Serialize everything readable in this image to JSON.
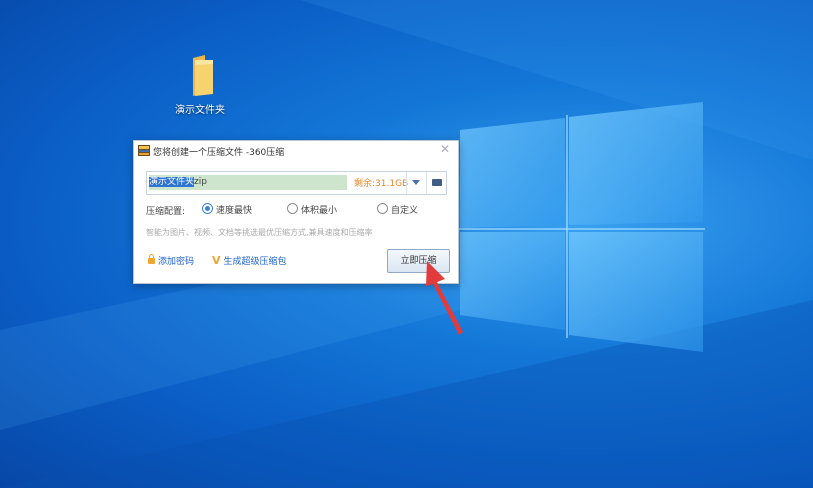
{
  "desktop": {
    "icons": [
      {
        "label": "演示文件夹",
        "icon": "folder-icon"
      }
    ]
  },
  "dialog": {
    "title": "您将创建一个压缩文件 -360压缩",
    "close_icon": "close-icon",
    "path": {
      "selected_text": "演示文件夹",
      "extension_text": "zip",
      "free_space": "剩余:31.1GB"
    },
    "mode": {
      "label": "压缩配置:",
      "options": [
        {
          "label": "速度最快",
          "selected": true
        },
        {
          "label": "体积最小",
          "selected": false
        },
        {
          "label": "自定义",
          "selected": false
        }
      ]
    },
    "hint": "智能为图片、视频、文档等挑选最优压缩方式,兼具速度和压缩率",
    "links": {
      "password": "添加密码",
      "super": "生成超级压缩包"
    },
    "compress_button": "立即压缩"
  },
  "colors": {
    "accent": "#1b62c7",
    "warning": "#e6862a",
    "annotation_arrow": "#e23b3b"
  }
}
